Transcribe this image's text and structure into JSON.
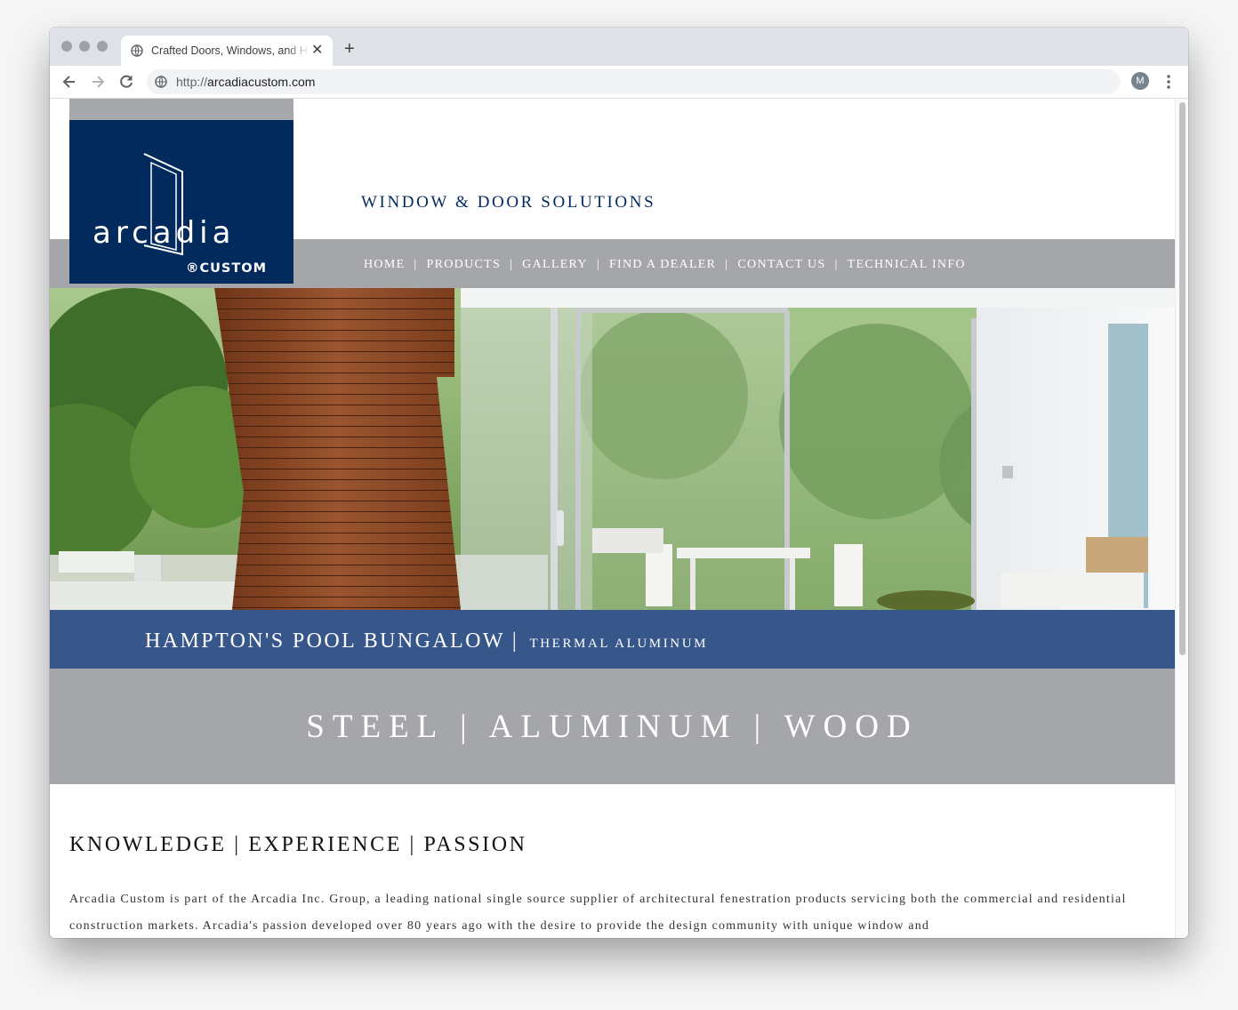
{
  "browser": {
    "tab_title": "Crafted Doors, Windows, and H",
    "url_protocol": "http://",
    "url_host": "arcadiacustom.com",
    "profile_initial": "M"
  },
  "site": {
    "logo_word": "arcadia",
    "logo_sub": "®CUSTOM",
    "tagline": "WINDOW & DOOR SOLUTIONS",
    "nav": [
      {
        "label": "HOME"
      },
      {
        "label": "PRODUCTS"
      },
      {
        "label": "GALLERY"
      },
      {
        "label": "FIND A DEALER"
      },
      {
        "label": "CONTACT US"
      },
      {
        "label": "TECHNICAL INFO"
      }
    ],
    "nav_separator": "|",
    "hero": {
      "title": "HAMPTON'S POOL BUNGALOW",
      "separator": "|",
      "subtitle": "THERMAL ALUMINUM"
    },
    "materials": "STEEL | ALUMINUM | WOOD",
    "section_heading": "KNOWLEDGE | EXPERIENCE | PASSION",
    "body": "Arcadia Custom is part of the Arcadia Inc. Group, a leading national single source supplier of architectural fenestration products servicing both the commercial and residential construction markets. Arcadia's passion developed over 80 years ago with the desire to provide the design community with unique window and"
  },
  "colors": {
    "brand_navy": "#022a5d",
    "nav_gray": "#a4a6aa",
    "caption_blue": "#264c8c"
  }
}
